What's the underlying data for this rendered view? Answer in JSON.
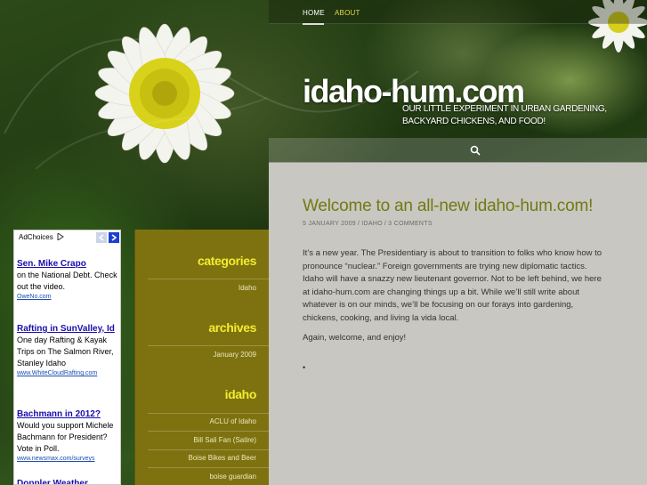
{
  "nav": {
    "items": [
      {
        "label": "HOME"
      },
      {
        "label": "ABOUT"
      }
    ]
  },
  "header": {
    "site_title": "idaho-hum.com",
    "tagline": "Our little experiment in urban gardening, backyard chickens, and food!"
  },
  "post": {
    "title": "Welcome to an all-new idaho-hum.com!",
    "date": "5 January 2009",
    "category": "Idaho",
    "comments": "3 Comments",
    "paragraphs": [
      "It’s a new year.  The Presidentiary is about to transition to folks who know how to pronounce “nuclear.”  Foreign governments are trying new diplomatic tactics.  Idaho will have a snazzy new lieutenant governor.  Not to be left behind, we here at idaho-hum.com are changing things up a bit. While we’ll still write about whatever is on our minds, we’ll be focusing on our forays into gardening, chickens, cooking, and living la vida local.",
      "Again, welcome, and enjoy!"
    ],
    "bullet": "•"
  },
  "sidebar": {
    "categories_heading": "categories",
    "categories": [
      "Idaho"
    ],
    "archives_heading": "archives",
    "archives": [
      "January 2009"
    ],
    "idaho_heading": "idaho",
    "idaho_links": [
      "ACLU of Idaho",
      "Bill Sali Fan (Satire)",
      "Boise Bikes and Beer",
      "boise guardian"
    ]
  },
  "ads": {
    "adchoices": "AdChoices",
    "items": [
      {
        "title": "Sen. Mike Crapo",
        "text": "on the National Debt. Check out the video.",
        "url": "OweNo.com"
      },
      {
        "title": "Rafting in SunValley, Id",
        "text": "One day Rafting & Kayak Trips on The Salmon River, Stanley Idaho",
        "url": "www.WhiteCloudRafting.com"
      },
      {
        "title": "Bachmann in 2012?",
        "text": "Would you support Michele Bachmann for President? Vote in Poll.",
        "url": "www.newsmax.com/surveys"
      },
      {
        "title": "Doppler Weather",
        "text": "",
        "url": ""
      }
    ]
  },
  "colors": {
    "title_green": "#727a12",
    "sidebar_olive": "#7e7210",
    "heading_yellow": "#f3ec2e",
    "content_gray": "#c8c7c2",
    "nav_active": "#e8d84a"
  },
  "icons": [
    "search-icon",
    "adchoices-icon",
    "chevron-left-icon",
    "chevron-right-icon"
  ]
}
